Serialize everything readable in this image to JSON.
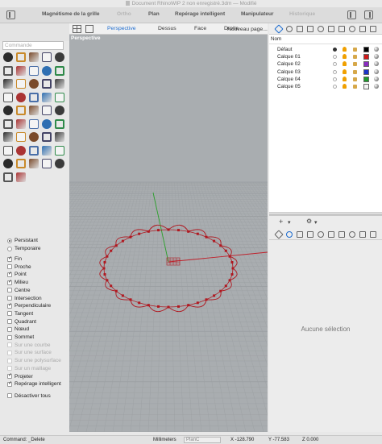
{
  "window": {
    "title": "Document RhinoWIP 2 non enregistré.3dm — Modifié"
  },
  "toolbar": {
    "toggles": [
      {
        "label": "Magnétisme de la grille",
        "active": true
      },
      {
        "label": "Ortho",
        "active": false
      },
      {
        "label": "Plan",
        "active": true
      },
      {
        "label": "Repérage intelligent",
        "active": true
      },
      {
        "label": "Manipulateur",
        "active": true
      },
      {
        "label": "Historique",
        "active": false
      }
    ]
  },
  "toolbox": {
    "search_placeholder": "Commande"
  },
  "osnap": {
    "mode_options": [
      {
        "label": "Persistant",
        "selected": true
      },
      {
        "label": "Temporaire",
        "selected": false
      }
    ],
    "snaps": [
      {
        "label": "Fin",
        "checked": true,
        "enabled": true
      },
      {
        "label": "Proche",
        "checked": false,
        "enabled": true
      },
      {
        "label": "Point",
        "checked": true,
        "enabled": true
      },
      {
        "label": "Milieu",
        "checked": true,
        "enabled": true
      },
      {
        "label": "Centre",
        "checked": false,
        "enabled": true
      },
      {
        "label": "Intersection",
        "checked": false,
        "enabled": true
      },
      {
        "label": "Perpendiculaire",
        "checked": true,
        "enabled": true
      },
      {
        "label": "Tangent",
        "checked": false,
        "enabled": true
      },
      {
        "label": "Quadrant",
        "checked": false,
        "enabled": true
      },
      {
        "label": "Nœud",
        "checked": false,
        "enabled": true
      },
      {
        "label": "Sommet",
        "checked": false,
        "enabled": true
      },
      {
        "label": "Sur une courbe",
        "checked": false,
        "enabled": false
      },
      {
        "label": "Sur une surface",
        "checked": false,
        "enabled": false
      },
      {
        "label": "Sur une polysurface",
        "checked": false,
        "enabled": false
      },
      {
        "label": "Sur un maillage",
        "checked": false,
        "enabled": false
      },
      {
        "label": "Projeter",
        "checked": true,
        "enabled": true
      },
      {
        "label": "Repérage intelligent",
        "checked": true,
        "enabled": true
      }
    ],
    "disable_all": "Désactiver tous"
  },
  "viewport": {
    "tabs": [
      "Perspective",
      "Dessus",
      "Face",
      "Droite",
      "Nouveau page..."
    ],
    "active_tab": "Perspective",
    "label": "Perspective",
    "axis_colors": {
      "x": "#c0202a",
      "y": "#2aa02a"
    },
    "curve_color": "#b01820"
  },
  "layers": {
    "header": "Nom",
    "rows": [
      {
        "name": "Défaut",
        "current": true,
        "color": "#000000"
      },
      {
        "name": "Calque 01",
        "current": false,
        "color": "#d21a1a"
      },
      {
        "name": "Calque 02",
        "current": false,
        "color": "#8a2cc0"
      },
      {
        "name": "Calque 03",
        "current": false,
        "color": "#1b34c8"
      },
      {
        "name": "Calque 04",
        "current": false,
        "color": "#1e9a2c"
      },
      {
        "name": "Calque 05",
        "current": false,
        "color": "#f4f4f4"
      }
    ]
  },
  "properties": {
    "empty_message": "Aucune sélection"
  },
  "statusbar": {
    "command": "Command: _Delete",
    "units": "Millimeters",
    "cplane": "PlanC",
    "x": "X -128.790",
    "y": "Y -77.583",
    "z": "Z 0.000"
  }
}
